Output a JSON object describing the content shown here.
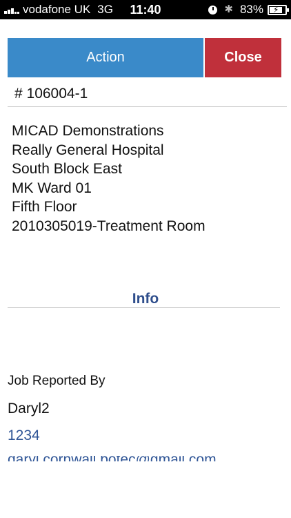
{
  "status_bar": {
    "carrier": "vodafone UK",
    "network": "3G",
    "time": "11:40",
    "battery": "83%",
    "battery_level": 0.83
  },
  "toolbar": {
    "action_label": "Action",
    "close_label": "Close"
  },
  "job": {
    "number": "# 106004-1"
  },
  "location": {
    "lines": [
      "MICAD Demonstrations",
      "Really General Hospital",
      "South Block East",
      "MK Ward 01",
      "Fifth Floor",
      "2010305019-Treatment Room"
    ]
  },
  "info": {
    "title": "Info",
    "reported_by_label": "Job Reported By",
    "reported_by_name": "Daryl2",
    "reported_by_phone": "1234",
    "reported_by_email": "daryl.cornwall.botec@gmail.com"
  },
  "colors": {
    "action": "#3a8ac9",
    "close": "#c0303b",
    "info_title": "#2f4e8c",
    "link": "#2f5596"
  }
}
